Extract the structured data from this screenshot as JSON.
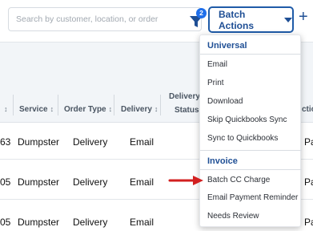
{
  "search": {
    "placeholder": "Search by customer, location, or order"
  },
  "filter": {
    "badge_count": "2",
    "icon": "filter-icon"
  },
  "batch_actions": {
    "label": "Batch Actions",
    "icon": "caret-down-icon"
  },
  "add": {
    "label": "+"
  },
  "table": {
    "columns": [
      {
        "label": "",
        "sort": "↕"
      },
      {
        "label": "Service",
        "sort": "↕"
      },
      {
        "label": "Order Type",
        "sort": "↕"
      },
      {
        "label": "Delivery",
        "sort": "↕"
      },
      {
        "label": "Delivery",
        "label2": "Status"
      }
    ],
    "right_partial_header": "ctio",
    "rows": [
      {
        "id_fragment": "63",
        "service": "Dumpster",
        "order_type": "Delivery",
        "delivery": "Email",
        "right_fragment": "Pa"
      },
      {
        "id_fragment": "05",
        "service": "Dumpster",
        "order_type": "Delivery",
        "delivery": "Email",
        "right_fragment": "Pa"
      },
      {
        "id_fragment": "05",
        "service": "Dumpster",
        "order_type": "Delivery",
        "delivery": "Email",
        "right_fragment": "Pa"
      }
    ]
  },
  "menu": {
    "universal_title": "Universal",
    "universal_items": [
      "Email",
      "Print",
      "Download",
      "Skip Quickbooks Sync",
      "Sync to Quickbooks"
    ],
    "invoice_title": "Invoice",
    "invoice_items": [
      "Batch CC Charge",
      "Email Payment Reminder",
      "Needs Review"
    ]
  },
  "colors": {
    "accent": "#1f4f95",
    "badge": "#1f6feb",
    "arrow": "#d21f1f"
  }
}
